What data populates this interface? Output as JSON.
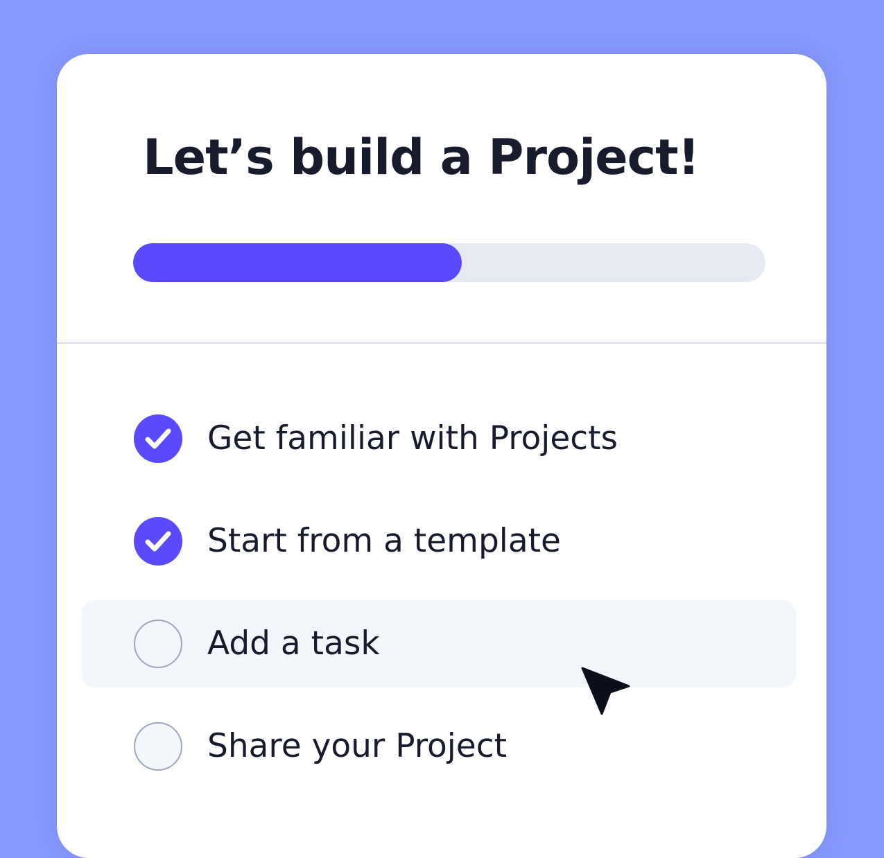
{
  "onboarding": {
    "title": "Let’s build a Project!",
    "progress": 0.52,
    "colors": {
      "background": "#8799fd",
      "accent": "#5a49ff",
      "track": "#e6eaf3",
      "text": "#171b2b",
      "highlight": "#f3f6fa"
    },
    "tasks": [
      {
        "label": "Get familiar with Projects",
        "status": "complete",
        "icon": "checkmark-circle-icon"
      },
      {
        "label": "Start from a template",
        "status": "complete",
        "icon": "checkmark-circle-icon"
      },
      {
        "label": "Add a task",
        "status": "incomplete",
        "icon": "empty-circle-icon",
        "highlighted": true
      },
      {
        "label": "Share your Project",
        "status": "incomplete",
        "icon": "empty-circle-icon"
      }
    ],
    "cursor_icon": "mouse-pointer-icon"
  }
}
